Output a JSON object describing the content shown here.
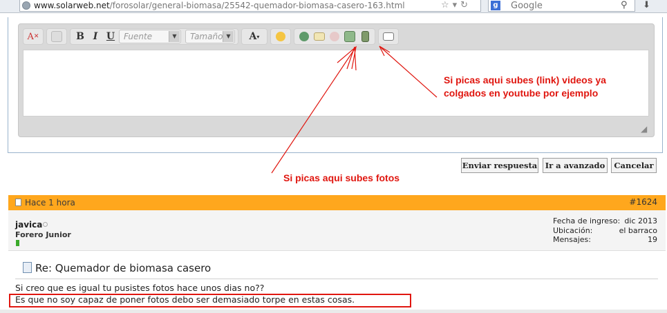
{
  "browser": {
    "url_prefix": "www.solarweb.net",
    "url_path": "/forosolar/general-biomasa/25542-quemador-biomasa-casero-163.html",
    "search_engine": "Google"
  },
  "editor": {
    "font_placeholder": "Fuente",
    "size_placeholder": "Tamaño",
    "buttons": {
      "bold": "B",
      "italic": "I",
      "underline": "U",
      "font_color": "A"
    }
  },
  "annotations": {
    "video_note_line1": "Si picas aqui subes (link) videos ya",
    "video_note_line2": "colgados en youtube por ejemplo",
    "photo_note": "Si picas aqui subes fotos"
  },
  "actions": {
    "send": "Enviar respuesta",
    "advanced": "Ir a avanzado",
    "cancel": "Cancelar"
  },
  "post": {
    "time": "Hace 1 hora",
    "number": "#1624",
    "user": "javica",
    "rank": "Forero Junior",
    "meta_labels": [
      "Fecha de ingreso:",
      "Ubicación:",
      "Mensajes:"
    ],
    "meta_values": [
      "dic 2013",
      "el barraco",
      "19"
    ],
    "title": "Re: Quemador de biomasa casero",
    "line1": "Si creo que es igual tu pusistes fotos hace unos dias no??",
    "line2": "Es que no soy capaz de poner fotos debo ser demasiado torpe en estas cosas."
  },
  "colors": {
    "annotation": "#e0160f",
    "post_header": "#ffa71d",
    "reputation": "#3aaa2a"
  }
}
